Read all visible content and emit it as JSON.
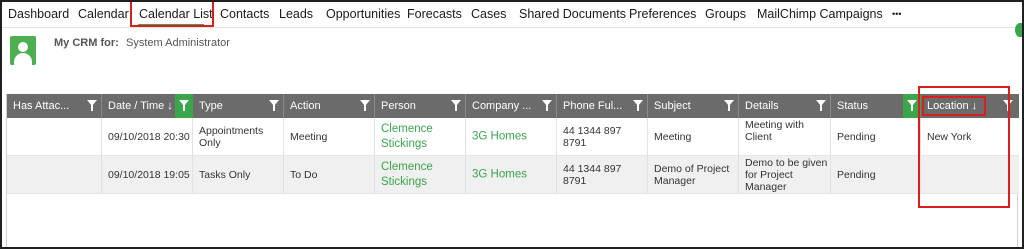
{
  "nav": {
    "items": [
      {
        "label": "Dashboard"
      },
      {
        "label": "Calendar"
      },
      {
        "label": "Calendar List"
      },
      {
        "label": "Contacts"
      },
      {
        "label": "Leads"
      },
      {
        "label": "Opportunities"
      },
      {
        "label": "Forecasts"
      },
      {
        "label": "Cases"
      },
      {
        "label": "Shared Documents"
      },
      {
        "label": "Preferences"
      },
      {
        "label": "Groups"
      },
      {
        "label": "MailChimp Campaigns"
      },
      {
        "label": "•••"
      }
    ],
    "active": "Calendar List"
  },
  "header": {
    "crm_label": "My CRM for:",
    "user": "System Administrator"
  },
  "grid": {
    "columns": [
      {
        "label": "Has Attac..."
      },
      {
        "label": "Date / Time ↓"
      },
      {
        "label": "Type"
      },
      {
        "label": "Action"
      },
      {
        "label": "Person"
      },
      {
        "label": "Company ..."
      },
      {
        "label": "Phone Ful..."
      },
      {
        "label": "Subject"
      },
      {
        "label": "Details"
      },
      {
        "label": "Status"
      },
      {
        "label": "Location ↓"
      }
    ],
    "rows": [
      {
        "has_attachment": "",
        "datetime": "09/10/2018 20:30",
        "type_line1": "Appointments",
        "type_line2": "Only",
        "action": "Meeting",
        "person_line1": "Clemence",
        "person_line2": "Stickings",
        "company": "3G Homes",
        "phone": "44 1344 897 8791",
        "subject_line1": "Meeting",
        "subject_line2": "",
        "details_line1": "Meeting with Client",
        "details_line2": "",
        "details_line3": "",
        "status": "Pending",
        "location": "New York"
      },
      {
        "has_attachment": "",
        "datetime": "09/10/2018 19:05",
        "type_line1": "Tasks Only",
        "type_line2": "",
        "action": "To Do",
        "person_line1": "Clemence",
        "person_line2": "Stickings",
        "company": "3G Homes",
        "phone": "44 1344 897 8791",
        "subject_line1": "Demo of Project",
        "subject_line2": "Manager",
        "details_line1": "Demo to be given",
        "details_line2": "for Project",
        "details_line3": "Manager",
        "status": "Pending",
        "location": ""
      }
    ]
  },
  "colors": {
    "accent_green": "#3aa54a",
    "header_gray": "#6b6b6b",
    "highlight_red": "#d81e1e"
  }
}
